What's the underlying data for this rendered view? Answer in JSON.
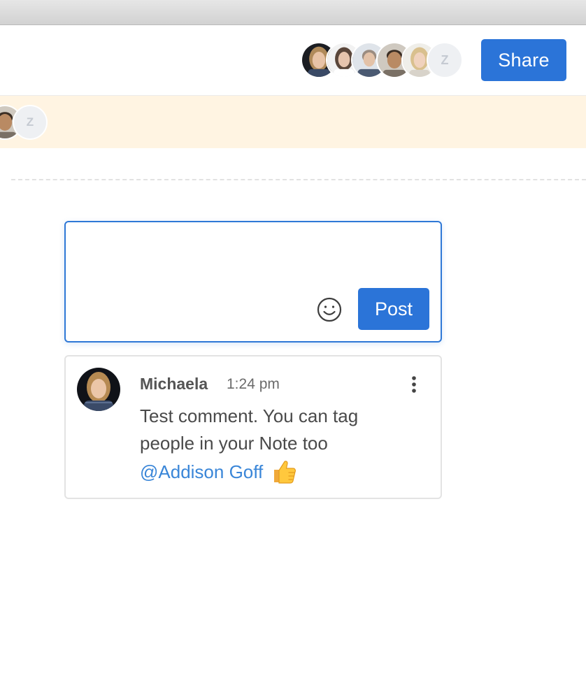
{
  "header": {
    "share_label": "Share",
    "collaborators": [
      {
        "name": "collaborator-1"
      },
      {
        "name": "collaborator-2"
      },
      {
        "name": "collaborator-3"
      },
      {
        "name": "collaborator-4"
      },
      {
        "name": "collaborator-5"
      },
      {
        "initial": "Z"
      }
    ]
  },
  "presence_banner": {
    "viewer_initial": "Z"
  },
  "composer": {
    "value": "",
    "placeholder": "",
    "emoji_icon": "smiley-face-icon",
    "post_label": "Post"
  },
  "comments": [
    {
      "author": "Michaela",
      "time": "1:24 pm",
      "text_before_mention": "Test comment. You can tag people in your Note too ",
      "mention": "@Addison Goff",
      "reaction_icon": "thumbs-up-icon"
    }
  ],
  "colors": {
    "accent": "#2b74d8",
    "mention": "#3a86d8",
    "banner": "#fff4e2",
    "composer_border": "#2f78d6"
  }
}
